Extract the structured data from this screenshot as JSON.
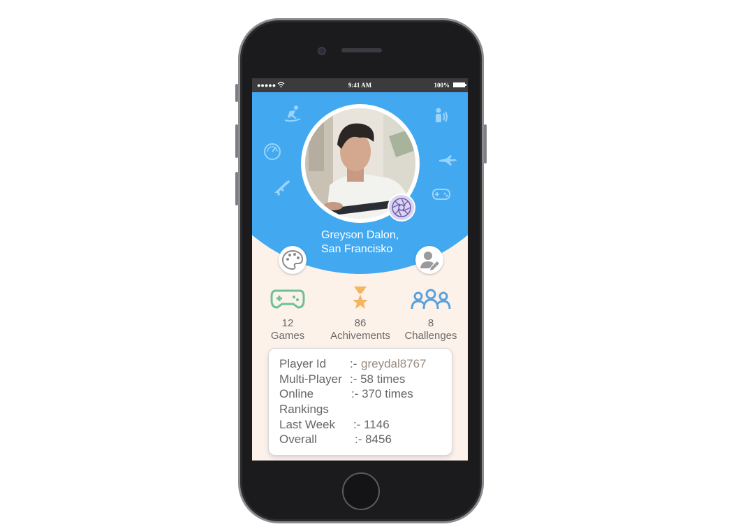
{
  "status_bar": {
    "signal": "●●●●●",
    "time": "9:41 AM",
    "battery": "100%"
  },
  "profile": {
    "name_line1": "Greyson Dalon,",
    "name_line2": "San Francisko"
  },
  "stats": [
    {
      "value": "12",
      "label": "Games",
      "icon": "gamepad-icon"
    },
    {
      "value": "86",
      "label": "Achivements",
      "icon": "trophy-star-icon"
    },
    {
      "value": "8",
      "label": "Challenges",
      "icon": "group-icon"
    }
  ],
  "details": {
    "player_id_label": "Player Id",
    "player_id_sep": ":-",
    "player_id_value": "greydal8767",
    "multiplayer_label": "Multi-Player",
    "multiplayer_value": ":- 58 times",
    "online_label": "Online",
    "online_value": ":- 370 times",
    "rankings_label": "Rankings",
    "last_week_label": "Last Week",
    "last_week_value": ":- 1146",
    "overall_label": "Overall",
    "overall_value": ":- 8456"
  },
  "colors": {
    "header": "#42a9f1",
    "background": "#fdf2ea",
    "games": "#6cc196",
    "achievements": "#f4b563",
    "challenges": "#5aa2dd"
  },
  "icons": {
    "left": [
      "surfing-icon",
      "speedometer-icon",
      "rifle-icon"
    ],
    "right": [
      "speaker-person-icon",
      "plane-icon",
      "controller-icon"
    ],
    "buttons": [
      "palette-icon",
      "edit-user-icon",
      "camera-aperture-icon"
    ]
  }
}
